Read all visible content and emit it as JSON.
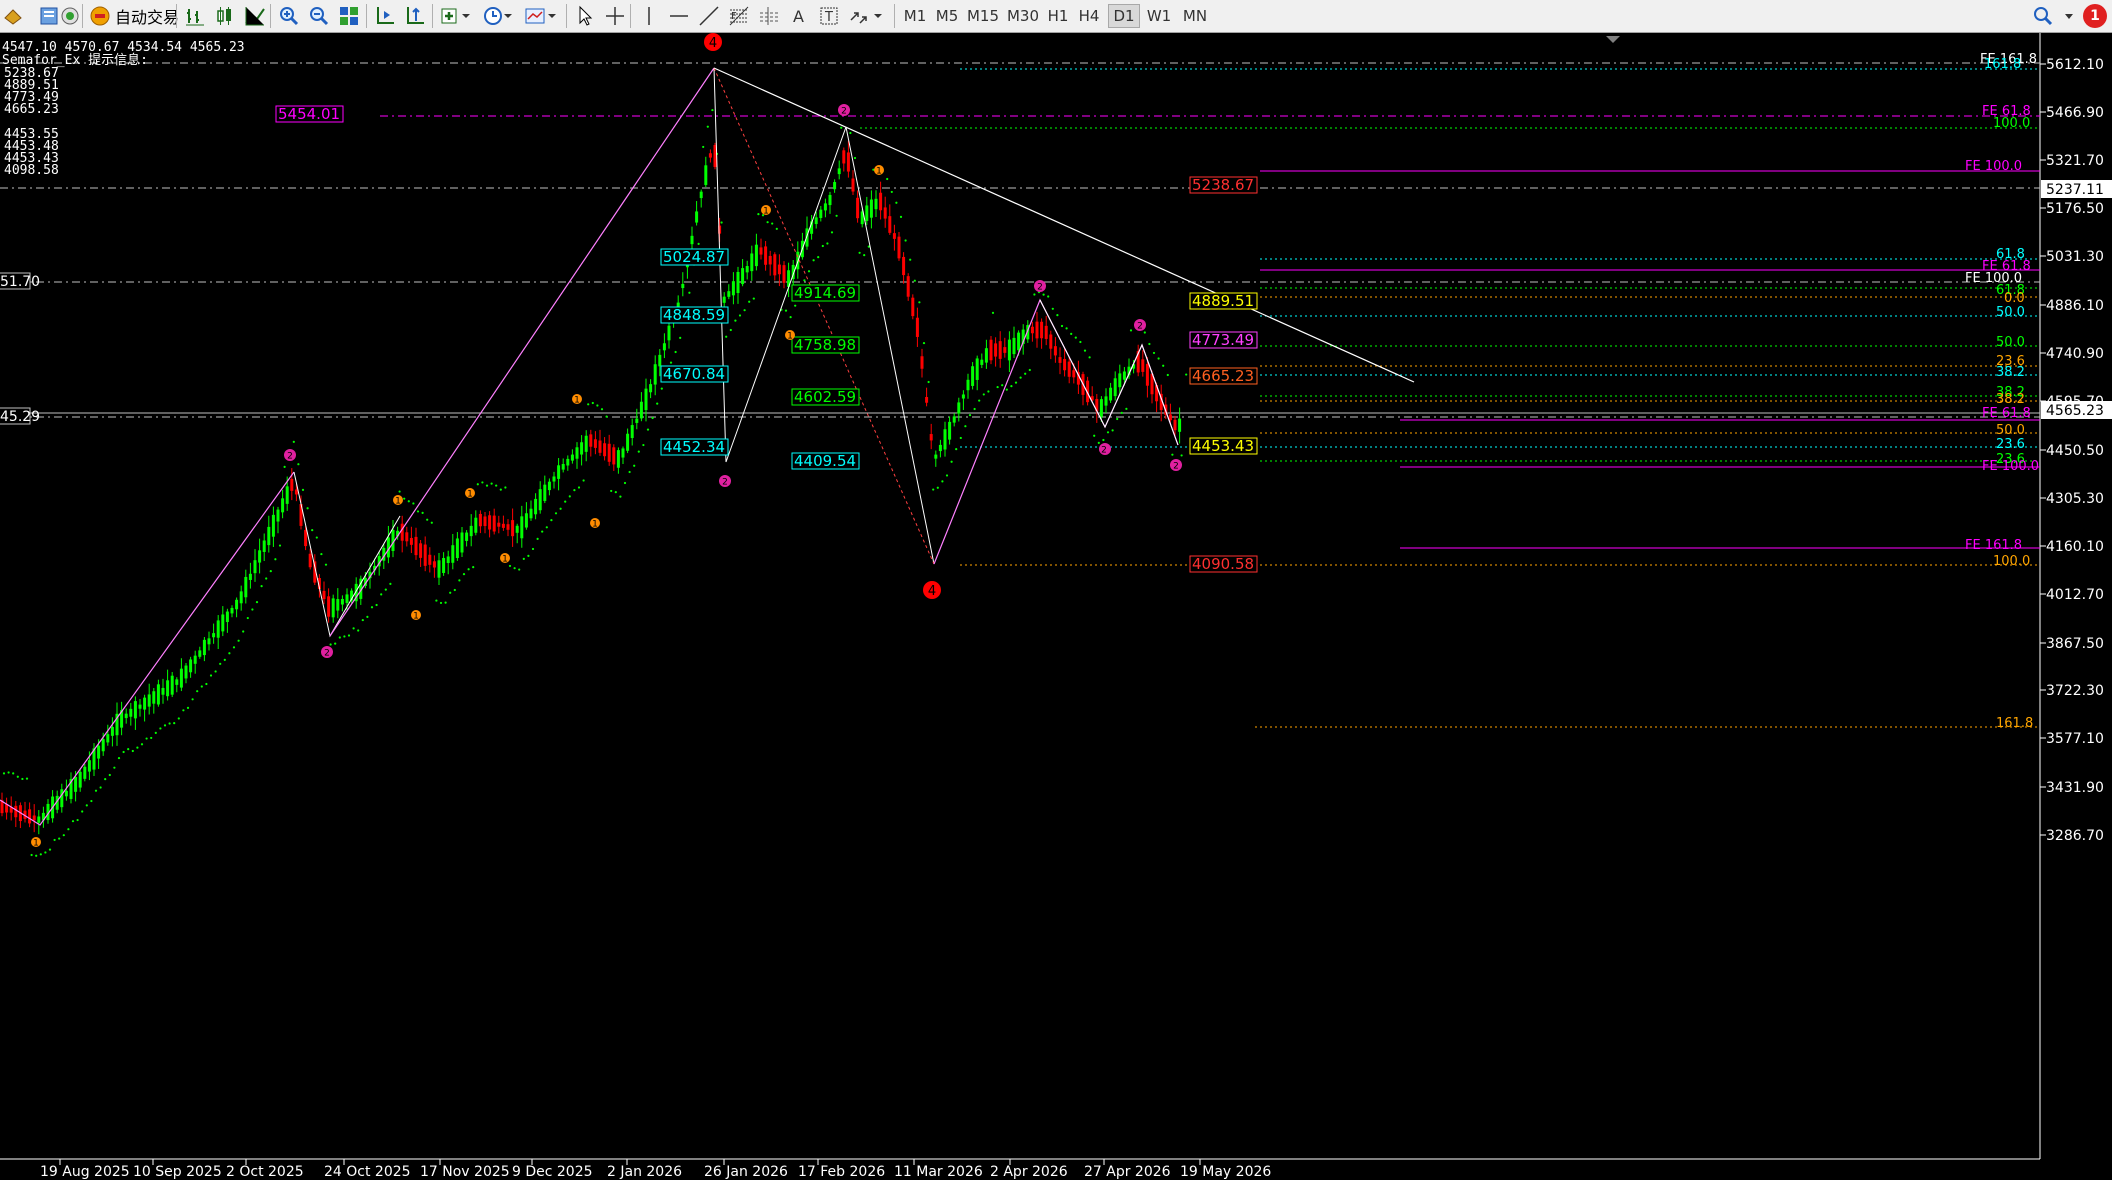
{
  "toolbar": {
    "autotrade_label": "自动交易",
    "timeframes": [
      "M1",
      "M5",
      "M15",
      "M30",
      "H1",
      "H4",
      "D1",
      "W1",
      "MN"
    ],
    "active_timeframe": "D1",
    "notification_count": "1",
    "icons": [
      "new-order-icon",
      "metaeditor-icon",
      "market-watch-icon",
      "autotrade-icon",
      "bar-chart-icon",
      "candlestick-icon",
      "line-chart-icon",
      "zoom-in-icon",
      "zoom-out-icon",
      "tile-windows-icon",
      "auto-scroll-icon",
      "chart-shift-icon",
      "indicators-icon",
      "periods-icon",
      "templates-icon",
      "cursor-icon",
      "crosshair-icon",
      "vertical-line-icon",
      "horizontal-line-icon",
      "trendline-icon",
      "fibonacci-icon",
      "channels-icon",
      "text-icon",
      "text-label-icon",
      "arrows-icon",
      "search-icon",
      "notifications-icon"
    ]
  },
  "chart_info": {
    "ohlc": "4547.10 4570.67 4534.54 4565.23",
    "indicator_title": "Semafor_Ex 提示信息:",
    "indicator_values": [
      "5238.67",
      "4889.51",
      "4773.49",
      "4665.23",
      "4453.55",
      "4453.48",
      "4453.43",
      "4098.58"
    ]
  },
  "price_axis": {
    "labels": [
      "5612.10",
      "5466.90",
      "5321.70",
      "5176.50",
      "5031.30",
      "4886.10",
      "4740.90",
      "4595.70",
      "4450.50",
      "4305.30",
      "4160.10",
      "4012.70",
      "3867.50",
      "3722.30",
      "3577.10",
      "3431.90",
      "3286.70"
    ],
    "current_price": "5237.11",
    "bid_price": "4565.23"
  },
  "date_axis": {
    "labels": [
      "19 Aug 2025",
      "10 Sep 2025",
      "2 Oct 2025",
      "24 Oct 2025",
      "17 Nov 2025",
      "9 Dec 2025",
      "2 Jan 2026",
      "26 Jan 2026",
      "17 Feb 2026",
      "11 Mar 2026",
      "2 Apr 2026",
      "27 Apr 2026",
      "19 May 2026"
    ]
  },
  "left_labels": {
    "upper": "51.70",
    "lower": "45.29"
  },
  "price_boxes": [
    {
      "text": "5454.01",
      "color": "#ff00ff",
      "bg": "#000"
    },
    {
      "text": "5024.87",
      "color": "#00ffff",
      "bg": "#000"
    },
    {
      "text": "4848.59",
      "color": "#00ffff",
      "bg": "#000"
    },
    {
      "text": "4670.84",
      "color": "#00ffff",
      "bg": "#000"
    },
    {
      "text": "4452.34",
      "color": "#00ffff",
      "bg": "#000"
    },
    {
      "text": "4914.69",
      "color": "#00ff00",
      "bg": "#000"
    },
    {
      "text": "4758.98",
      "color": "#00ff00",
      "bg": "#000"
    },
    {
      "text": "4602.59",
      "color": "#00ff00",
      "bg": "#000"
    },
    {
      "text": "4409.54",
      "color": "#00ffff",
      "bg": "#000"
    },
    {
      "text": "5238.67",
      "color": "#ff3030",
      "bg": "#000"
    },
    {
      "text": "4889.51",
      "color": "#ffff00",
      "bg": "#000"
    },
    {
      "text": "4773.49",
      "color": "#ff40ff",
      "bg": "#000"
    },
    {
      "text": "4665.23",
      "color": "#ff6020",
      "bg": "#000"
    },
    {
      "text": "4453.43",
      "color": "#ffff00",
      "bg": "#000"
    },
    {
      "text": "4090.58",
      "color": "#ff3030",
      "bg": "#000"
    }
  ],
  "fib_labels": [
    {
      "text": "FE 161.8",
      "color": "#ffffff"
    },
    {
      "text": "161.8",
      "color": "#00ffff"
    },
    {
      "text": "FE 61.8",
      "color": "#ff00ff"
    },
    {
      "text": "100.0",
      "color": "#00ff00"
    },
    {
      "text": "FE 100.0",
      "color": "#ff00ff"
    },
    {
      "text": "61.8",
      "color": "#00ffff"
    },
    {
      "text": "FE 61.8",
      "color": "#ff00ff"
    },
    {
      "text": "FE 100.0",
      "color": "#ffffff"
    },
    {
      "text": "61.8",
      "color": "#00ff00"
    },
    {
      "text": "0.0",
      "color": "#ffa500"
    },
    {
      "text": "50.0",
      "color": "#00ffff"
    },
    {
      "text": "50.0",
      "color": "#00ff00"
    },
    {
      "text": "23.6",
      "color": "#ffa500"
    },
    {
      "text": "38.2",
      "color": "#00ffff"
    },
    {
      "text": "38.2",
      "color": "#00ff00"
    },
    {
      "text": "38.2",
      "color": "#ffa500"
    },
    {
      "text": "FE 61.8",
      "color": "#ff00ff"
    },
    {
      "text": "50.0",
      "color": "#ffa500"
    },
    {
      "text": "23.6",
      "color": "#00ffff"
    },
    {
      "text": "23.6",
      "color": "#00ff00"
    },
    {
      "text": "FE 100.0",
      "color": "#ff00ff"
    },
    {
      "text": "FE 161.8",
      "color": "#ff00ff"
    },
    {
      "text": "100.0",
      "color": "#ffa500"
    },
    {
      "text": "161.8",
      "color": "#ffa500"
    }
  ],
  "semafor_markers": [
    {
      "label": "4",
      "color": "#ff0000"
    },
    {
      "label": "4",
      "color": "#ff0000"
    },
    {
      "label": "2",
      "color": "#e020a0"
    },
    {
      "label": "2",
      "color": "#e020a0"
    },
    {
      "label": "2",
      "color": "#e020a0"
    },
    {
      "label": "2",
      "color": "#e020a0"
    },
    {
      "label": "2",
      "color": "#e020a0"
    },
    {
      "label": "2",
      "color": "#e020a0"
    },
    {
      "label": "2",
      "color": "#e020a0"
    },
    {
      "label": "2",
      "color": "#e020a0"
    },
    {
      "label": "2",
      "color": "#e020a0"
    },
    {
      "label": "1",
      "color": "#ff8c00"
    },
    {
      "label": "1",
      "color": "#ff8c00"
    },
    {
      "label": "1",
      "color": "#ff8c00"
    },
    {
      "label": "1",
      "color": "#ff8c00"
    },
    {
      "label": "1",
      "color": "#ff8c00"
    },
    {
      "label": "1",
      "color": "#ff8c00"
    },
    {
      "label": "1",
      "color": "#ff8c00"
    },
    {
      "label": "1",
      "color": "#ff8c00"
    },
    {
      "label": "1",
      "color": "#ff8c00"
    },
    {
      "label": "1",
      "color": "#ff8c00"
    }
  ],
  "colors": {
    "bull": "#00ff00",
    "bear": "#ff0000",
    "background": "#000000",
    "sar": "#00ff00"
  }
}
